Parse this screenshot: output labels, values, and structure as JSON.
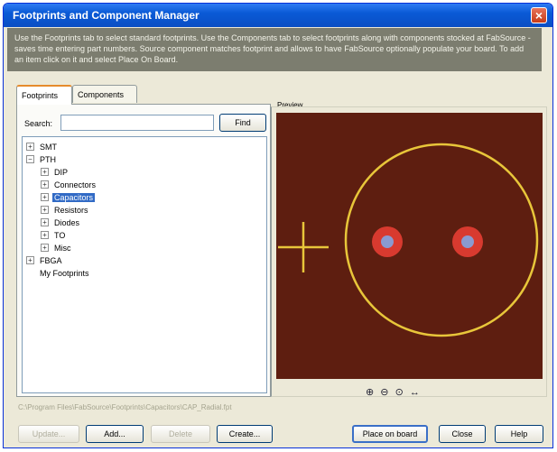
{
  "window": {
    "title": "Footprints and Component Manager",
    "close_glyph": "×",
    "description": "Use the Footprints tab to select standard footprints. Use the Components tab to select footprints along with components stocked at FabSource - saves time entering part numbers. Source component matches footprint and allows to have FabSource optionally populate your board. To add an item click on it and select Place On Board."
  },
  "tabs": [
    {
      "label": "Footprints",
      "active": true
    },
    {
      "label": "Components",
      "active": false
    }
  ],
  "search": {
    "label": "Search:",
    "value": "",
    "find_label": "Find"
  },
  "tree": [
    {
      "label": "SMT",
      "toggle": "+",
      "level": 0,
      "selected": false
    },
    {
      "label": "PTH",
      "toggle": "−",
      "level": 0,
      "selected": false
    },
    {
      "label": "DIP",
      "toggle": "+",
      "level": 1,
      "selected": false
    },
    {
      "label": "Connectors",
      "toggle": "+",
      "level": 1,
      "selected": false
    },
    {
      "label": "Capacitors",
      "toggle": "+",
      "level": 1,
      "selected": true
    },
    {
      "label": "Resistors",
      "toggle": "+",
      "level": 1,
      "selected": false
    },
    {
      "label": "Diodes",
      "toggle": "+",
      "level": 1,
      "selected": false
    },
    {
      "label": "TO",
      "toggle": "+",
      "level": 1,
      "selected": false
    },
    {
      "label": "Misc",
      "toggle": "+",
      "level": 1,
      "selected": false
    },
    {
      "label": "FBGA",
      "toggle": "+",
      "level": 0,
      "selected": false
    },
    {
      "label": "My Footprints",
      "toggle": "",
      "level": 0,
      "selected": false
    }
  ],
  "preview": {
    "label": "Preview",
    "background": "#5e1e10",
    "outline_color": "#e8c63a",
    "pad_color": "#d83a2f",
    "drill_color": "#8a9ad0"
  },
  "zoom_icons": [
    "zoom-in-icon",
    "zoom-out-icon",
    "zoom-fit-icon",
    "zoom-reset-icon"
  ],
  "zoom_glyphs": [
    "⊕",
    "⊖",
    "⊙",
    "↔"
  ],
  "path_text": "C:\\Program Files\\FabSource\\Footprints\\Capacitors\\CAP_Radial.fpt",
  "buttons": {
    "update": "Update...",
    "add": "Add...",
    "delete": "Delete",
    "create": "Create...",
    "place": "Place on board",
    "close": "Close",
    "help": "Help"
  }
}
